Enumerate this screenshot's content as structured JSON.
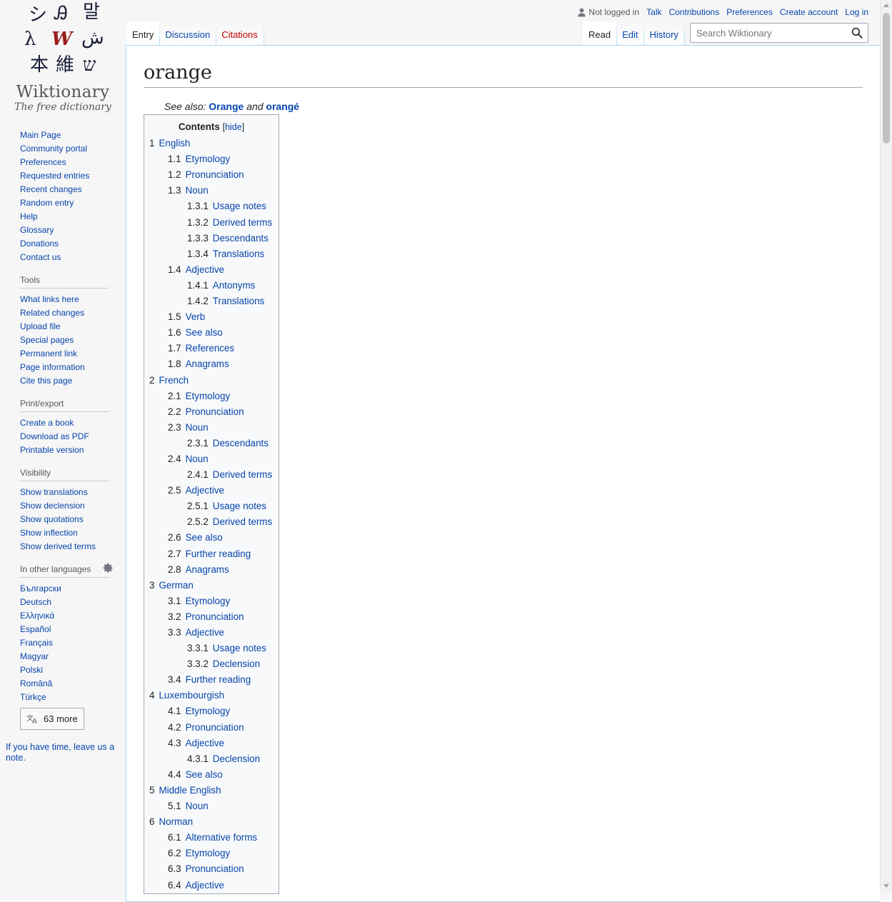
{
  "logo": {
    "wordmark": "Wiktionary",
    "tagline": "The free dictionary",
    "glyphs": [
      "シ",
      "Ꭿ",
      "말",
      "λ",
      "W",
      "ش",
      "^",
      "維",
      "ש"
    ]
  },
  "personal": {
    "anon_label": "Not logged in",
    "links": [
      "Talk",
      "Contributions",
      "Preferences",
      "Create account",
      "Log in"
    ]
  },
  "tabs": {
    "left": [
      {
        "label": "Entry",
        "selected": true
      },
      {
        "label": "Discussion",
        "selected": false
      },
      {
        "label": "Citations",
        "selected": false
      }
    ],
    "right": [
      {
        "label": "Read",
        "selected": true
      },
      {
        "label": "Edit",
        "selected": false
      },
      {
        "label": "History",
        "selected": false
      }
    ]
  },
  "search": {
    "placeholder": "Search Wiktionary"
  },
  "sidebar": {
    "navigation": [
      "Main Page",
      "Community portal",
      "Preferences",
      "Requested entries",
      "Recent changes",
      "Random entry",
      "Help",
      "Glossary",
      "Donations",
      "Contact us"
    ],
    "tools": {
      "heading": "Tools",
      "items": [
        "What links here",
        "Related changes",
        "Upload file",
        "Special pages",
        "Permanent link",
        "Page information",
        "Cite this page"
      ]
    },
    "print": {
      "heading": "Print/export",
      "items": [
        "Create a book",
        "Download as PDF",
        "Printable version"
      ]
    },
    "visibility": {
      "heading": "Visibility",
      "items": [
        "Show translations",
        "Show declension",
        "Show quotations",
        "Show inflection",
        "Show derived terms"
      ]
    },
    "languages": {
      "heading": "In other languages",
      "items": [
        "Български",
        "Deutsch",
        "Ελληνικά",
        "Español",
        "Français",
        "Magyar",
        "Polski",
        "Română",
        "Türkçe"
      ],
      "more_label": "63 more"
    },
    "leave_note": "If you have time, leave us a note."
  },
  "page": {
    "title": "orange",
    "see_also_prefix": "See also:",
    "see_also_link1": "Orange",
    "see_also_and": "and",
    "see_also_link2": "orangé"
  },
  "toc": {
    "title": "Contents",
    "toggle": "hide",
    "items": [
      {
        "num": "1",
        "label": "English",
        "level": 1
      },
      {
        "num": "1.1",
        "label": "Etymology",
        "level": 2
      },
      {
        "num": "1.2",
        "label": "Pronunciation",
        "level": 2
      },
      {
        "num": "1.3",
        "label": "Noun",
        "level": 2
      },
      {
        "num": "1.3.1",
        "label": "Usage notes",
        "level": 3
      },
      {
        "num": "1.3.2",
        "label": "Derived terms",
        "level": 3
      },
      {
        "num": "1.3.3",
        "label": "Descendants",
        "level": 3
      },
      {
        "num": "1.3.4",
        "label": "Translations",
        "level": 3
      },
      {
        "num": "1.4",
        "label": "Adjective",
        "level": 2
      },
      {
        "num": "1.4.1",
        "label": "Antonyms",
        "level": 3
      },
      {
        "num": "1.4.2",
        "label": "Translations",
        "level": 3
      },
      {
        "num": "1.5",
        "label": "Verb",
        "level": 2
      },
      {
        "num": "1.6",
        "label": "See also",
        "level": 2
      },
      {
        "num": "1.7",
        "label": "References",
        "level": 2
      },
      {
        "num": "1.8",
        "label": "Anagrams",
        "level": 2
      },
      {
        "num": "2",
        "label": "French",
        "level": 1
      },
      {
        "num": "2.1",
        "label": "Etymology",
        "level": 2
      },
      {
        "num": "2.2",
        "label": "Pronunciation",
        "level": 2
      },
      {
        "num": "2.3",
        "label": "Noun",
        "level": 2
      },
      {
        "num": "2.3.1",
        "label": "Descendants",
        "level": 3
      },
      {
        "num": "2.4",
        "label": "Noun",
        "level": 2
      },
      {
        "num": "2.4.1",
        "label": "Derived terms",
        "level": 3
      },
      {
        "num": "2.5",
        "label": "Adjective",
        "level": 2
      },
      {
        "num": "2.5.1",
        "label": "Usage notes",
        "level": 3
      },
      {
        "num": "2.5.2",
        "label": "Derived terms",
        "level": 3
      },
      {
        "num": "2.6",
        "label": "See also",
        "level": 2
      },
      {
        "num": "2.7",
        "label": "Further reading",
        "level": 2
      },
      {
        "num": "2.8",
        "label": "Anagrams",
        "level": 2
      },
      {
        "num": "3",
        "label": "German",
        "level": 1
      },
      {
        "num": "3.1",
        "label": "Etymology",
        "level": 2
      },
      {
        "num": "3.2",
        "label": "Pronunciation",
        "level": 2
      },
      {
        "num": "3.3",
        "label": "Adjective",
        "level": 2
      },
      {
        "num": "3.3.1",
        "label": "Usage notes",
        "level": 3
      },
      {
        "num": "3.3.2",
        "label": "Declension",
        "level": 3
      },
      {
        "num": "3.4",
        "label": "Further reading",
        "level": 2
      },
      {
        "num": "4",
        "label": "Luxembourgish",
        "level": 1
      },
      {
        "num": "4.1",
        "label": "Etymology",
        "level": 2
      },
      {
        "num": "4.2",
        "label": "Pronunciation",
        "level": 2
      },
      {
        "num": "4.3",
        "label": "Adjective",
        "level": 2
      },
      {
        "num": "4.3.1",
        "label": "Declension",
        "level": 3
      },
      {
        "num": "4.4",
        "label": "See also",
        "level": 2
      },
      {
        "num": "5",
        "label": "Middle English",
        "level": 1
      },
      {
        "num": "5.1",
        "label": "Noun",
        "level": 2
      },
      {
        "num": "6",
        "label": "Norman",
        "level": 1
      },
      {
        "num": "6.1",
        "label": "Alternative forms",
        "level": 2
      },
      {
        "num": "6.2",
        "label": "Etymology",
        "level": 2
      },
      {
        "num": "6.3",
        "label": "Pronunciation",
        "level": 2
      },
      {
        "num": "6.4",
        "label": "Adjective",
        "level": 2
      }
    ]
  },
  "colors": {
    "link": "#0645ad",
    "new_link": "#ba0000",
    "text": "#202122",
    "border": "#a2a9b1",
    "tab_border": "#a7d7f9"
  }
}
